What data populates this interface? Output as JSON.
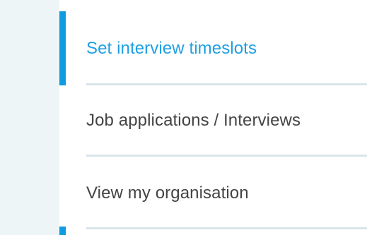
{
  "menu": {
    "items": [
      {
        "label": "Set interview timeslots",
        "active": true
      },
      {
        "label": "Job applications / Interviews",
        "active": false
      },
      {
        "label": "View my organisation",
        "active": false
      }
    ]
  },
  "colors": {
    "accent": "#0e9be0",
    "active_text": "#1f9fe2",
    "text": "#444444",
    "side_panel": "#edf5f6",
    "divider": "#d9e5e8"
  }
}
